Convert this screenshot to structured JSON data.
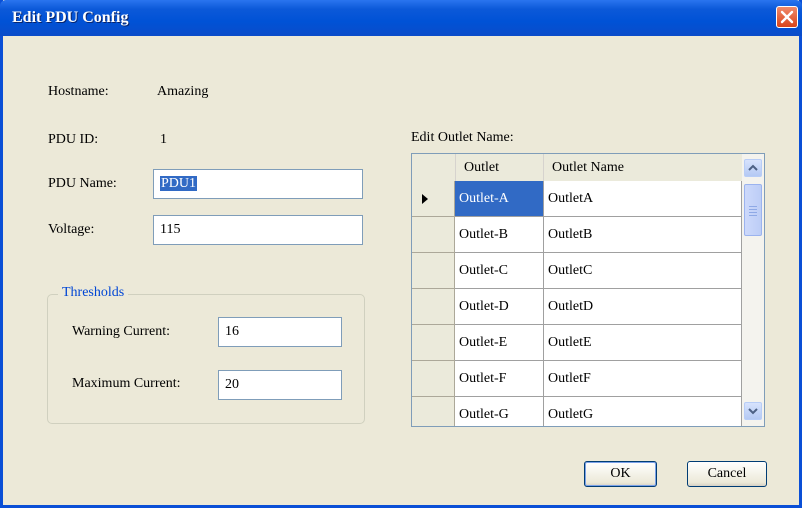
{
  "window": {
    "title": "Edit PDU Config"
  },
  "form": {
    "hostname_label": "Hostname:",
    "hostname_value": "Amazing",
    "pdu_id_label": "PDU ID:",
    "pdu_id_value": "1",
    "pdu_name_label": "PDU Name:",
    "pdu_name_value": "PDU1",
    "voltage_label": "Voltage:",
    "voltage_value": "115"
  },
  "thresholds": {
    "legend": "Thresholds",
    "warning_label": "Warning Current:",
    "warning_value": "16",
    "maximum_label": "Maximum Current:",
    "maximum_value": "20"
  },
  "outlets": {
    "label": "Edit Outlet Name:",
    "columns": [
      "Outlet",
      "Outlet Name"
    ],
    "rows": [
      [
        "Outlet-A",
        "OutletA"
      ],
      [
        "Outlet-B",
        "OutletB"
      ],
      [
        "Outlet-C",
        "OutletC"
      ],
      [
        "Outlet-D",
        "OutletD"
      ],
      [
        "Outlet-E",
        "OutletE"
      ],
      [
        "Outlet-F",
        "OutletF"
      ],
      [
        "Outlet-G",
        "OutletG"
      ]
    ],
    "selected_row": 0
  },
  "buttons": {
    "ok": "OK",
    "cancel": "Cancel"
  },
  "colors": {
    "titlebar": "#0052d6",
    "selection": "#316ac5",
    "group_legend": "#0046d5"
  }
}
